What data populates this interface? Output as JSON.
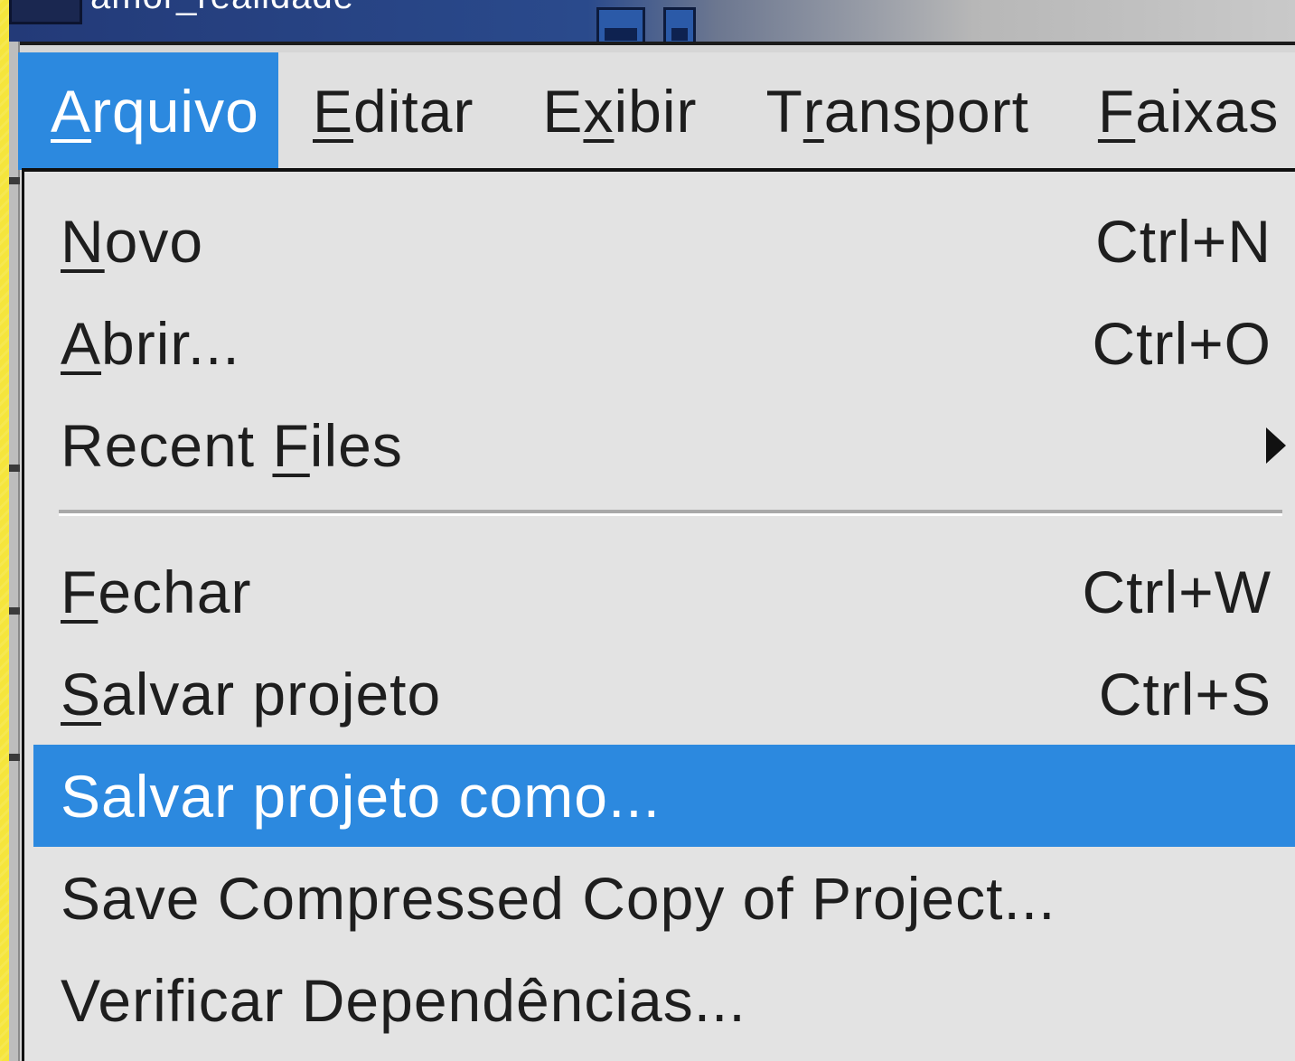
{
  "window": {
    "title": "amor_realidade"
  },
  "menubar": {
    "items": [
      {
        "pre": "",
        "key": "A",
        "post": "rquivo"
      },
      {
        "pre": "",
        "key": "E",
        "post": "ditar"
      },
      {
        "pre": "E",
        "key": "x",
        "post": "ibir"
      },
      {
        "pre": "T",
        "key": "r",
        "post": "ansport"
      },
      {
        "pre": "",
        "key": "F",
        "post": "aixas"
      }
    ]
  },
  "menu": {
    "items": [
      {
        "pre": "",
        "key": "N",
        "post": "ovo",
        "accel": "Ctrl+N"
      },
      {
        "pre": "",
        "key": "A",
        "post": "brir...",
        "accel": "Ctrl+O"
      },
      {
        "pre": "Recent ",
        "key": "F",
        "post": "iles",
        "submenu_icon": "submenu-arrow-icon"
      },
      {
        "pre": "",
        "key": "F",
        "post": "echar",
        "accel": "Ctrl+W"
      },
      {
        "pre": "",
        "key": "S",
        "post": "alvar projeto",
        "accel": "Ctrl+S"
      },
      {
        "label": "Salvar projeto como..."
      },
      {
        "label": "Save Compressed Copy of Project..."
      },
      {
        "label": "Verificar Dependências..."
      }
    ]
  },
  "colors": {
    "highlight": "#2c89df",
    "menu_bg": "#e3e3e3",
    "desktop": "#f3e33a"
  }
}
